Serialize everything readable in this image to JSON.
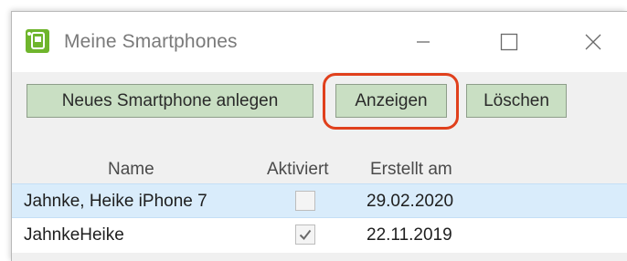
{
  "window": {
    "title": "Meine Smartphones",
    "icon": "smartphone-app-icon",
    "accent_color": "#6fb52c"
  },
  "toolbar": {
    "new_label": "Neues Smartphone anlegen",
    "show_label": "Anzeigen",
    "delete_label": "Löschen",
    "button_color": "#c9dfc3",
    "highlight_color": "#e0401c"
  },
  "grid": {
    "columns": [
      "Name",
      "Aktiviert",
      "Erstellt am"
    ],
    "rows": [
      {
        "name": "Jahnke, Heike iPhone 7",
        "activated": false,
        "created": "29.02.2020",
        "selected": true
      },
      {
        "name": "JahnkeHeike",
        "activated": true,
        "created": "22.11.2019",
        "selected": false
      }
    ],
    "selection_color": "#d9ecfb"
  }
}
